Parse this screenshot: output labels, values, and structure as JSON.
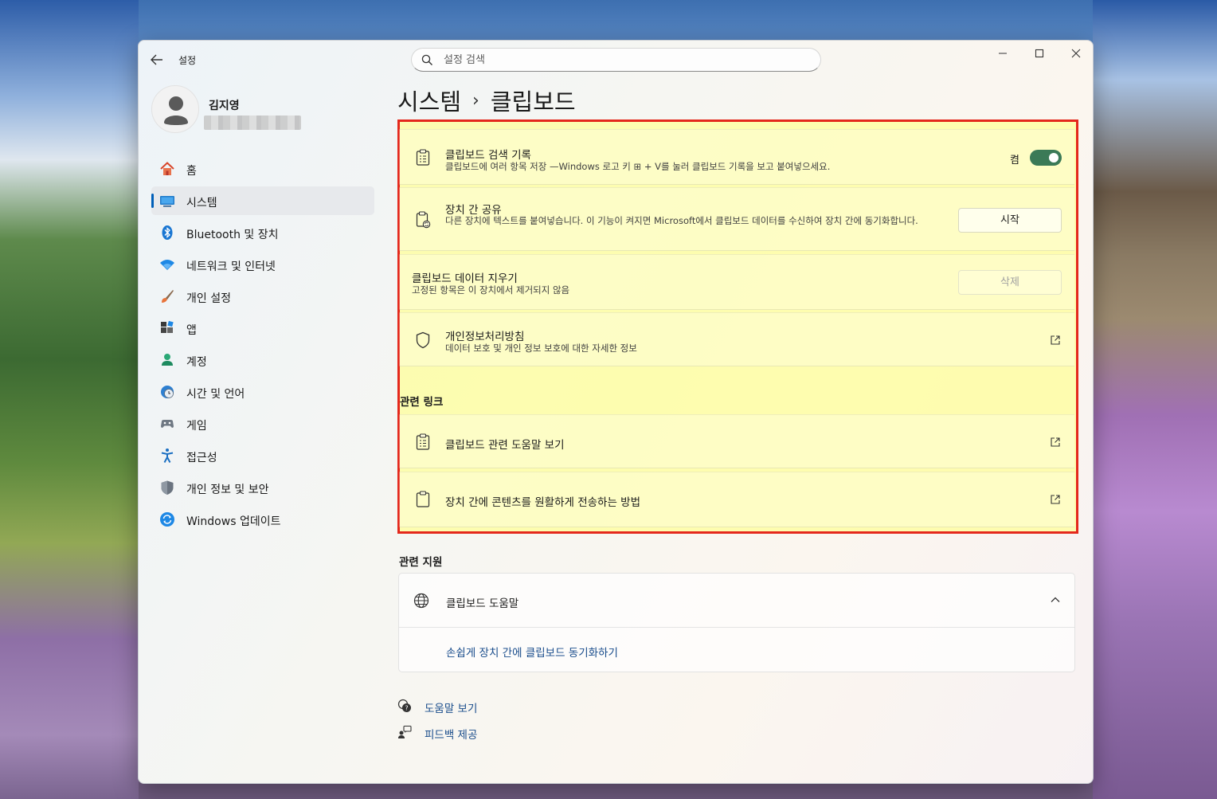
{
  "app": {
    "title": "설정",
    "search_placeholder": "설정 검색"
  },
  "profile": {
    "name": "김지영"
  },
  "sidebar": {
    "items": [
      {
        "label": "홈",
        "icon": "home-icon"
      },
      {
        "label": "시스템",
        "icon": "system-icon",
        "active": true
      },
      {
        "label": "Bluetooth 및 장치",
        "icon": "bluetooth-icon"
      },
      {
        "label": "네트워크 및 인터넷",
        "icon": "wifi-icon"
      },
      {
        "label": "개인 설정",
        "icon": "brush-icon"
      },
      {
        "label": "앱",
        "icon": "apps-icon"
      },
      {
        "label": "계정",
        "icon": "account-icon"
      },
      {
        "label": "시간 및 언어",
        "icon": "globe-clock-icon"
      },
      {
        "label": "게임",
        "icon": "gamepad-icon"
      },
      {
        "label": "접근성",
        "icon": "accessibility-icon"
      },
      {
        "label": "개인 정보 및 보안",
        "icon": "shield-icon"
      },
      {
        "label": "Windows 업데이트",
        "icon": "update-icon"
      }
    ]
  },
  "breadcrumb": {
    "parent": "시스템",
    "separator": "›",
    "current": "클립보드"
  },
  "settings": {
    "history": {
      "title": "클립보드 검색 기록",
      "description": "클립보드에 여러 항목 저장 —Windows 로고 키 ⊞ + V를 눌러 클립보드 기록을 보고 붙여넣으세요.",
      "state_label": "켬",
      "enabled": true
    },
    "share": {
      "title": "장치 간 공유",
      "description": "다른 장치에 텍스트를 붙여넣습니다. 이 기능이 켜지면 Microsoft에서 클립보드 데이터를 수신하여 장치 간에 동기화합니다.",
      "button": "시작"
    },
    "clear": {
      "title": "클립보드 데이터 지우기",
      "description": "고정된 항목은 이 장치에서 제거되지 않음",
      "button": "삭제"
    },
    "privacy": {
      "title": "개인정보처리방침",
      "description": "데이터 보호 및 개인 정보 보호에 대한 자세한 정보"
    }
  },
  "related_links": {
    "heading": "관련 링크",
    "items": [
      {
        "label": "클립보드 관련 도움말 보기"
      },
      {
        "label": "장치 간에 콘텐츠를 원활하게 전송하는 방법"
      }
    ]
  },
  "related_support": {
    "heading": "관련 지원",
    "title": "클립보드 도움말",
    "link": "손쉽게 장치 간에 클립보드 동기화하기"
  },
  "footer": {
    "help": "도움말 보기",
    "feedback": "피드백 제공"
  },
  "colors": {
    "accent": "#005fb8",
    "toggle_on": "#3b7a57",
    "highlight_border": "#e4281c",
    "highlight_fill": "#ffff96"
  }
}
